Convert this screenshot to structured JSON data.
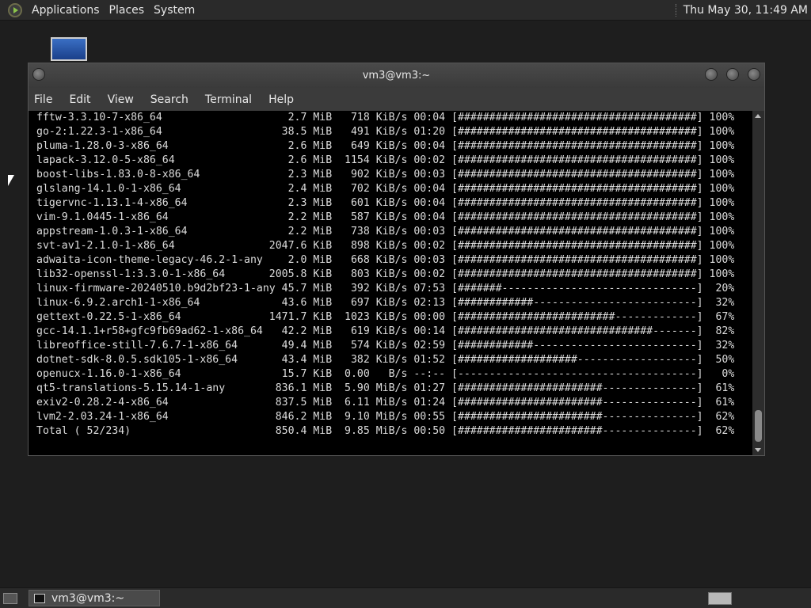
{
  "top_panel": {
    "menus": [
      "Applications",
      "Places",
      "System"
    ],
    "clock": "Thu May 30, 11:49 AM"
  },
  "window": {
    "title": "vm3@vm3:~",
    "menu": [
      "File",
      "Edit",
      "View",
      "Search",
      "Terminal",
      "Help"
    ]
  },
  "terminal": {
    "lines": [
      "fftw-3.3.10-7-x86_64                    2.7 MiB   718 KiB/s 00:04 [######################################] 100%",
      "go-2:1.22.3-1-x86_64                   38.5 MiB   491 KiB/s 01:20 [######################################] 100%",
      "pluma-1.28.0-3-x86_64                   2.6 MiB   649 KiB/s 00:04 [######################################] 100%",
      "lapack-3.12.0-5-x86_64                  2.6 MiB  1154 KiB/s 00:02 [######################################] 100%",
      "boost-libs-1.83.0-8-x86_64              2.3 MiB   902 KiB/s 00:03 [######################################] 100%",
      "glslang-14.1.0-1-x86_64                 2.4 MiB   702 KiB/s 00:04 [######################################] 100%",
      "tigervnc-1.13.1-4-x86_64                2.3 MiB   601 KiB/s 00:04 [######################################] 100%",
      "vim-9.1.0445-1-x86_64                   2.2 MiB   587 KiB/s 00:04 [######################################] 100%",
      "appstream-1.0.3-1-x86_64                2.2 MiB   738 KiB/s 00:03 [######################################] 100%",
      "svt-av1-2.1.0-1-x86_64               2047.6 KiB   898 KiB/s 00:02 [######################################] 100%",
      "adwaita-icon-theme-legacy-46.2-1-any    2.0 MiB   668 KiB/s 00:03 [######################################] 100%",
      "lib32-openssl-1:3.3.0-1-x86_64       2005.8 KiB   803 KiB/s 00:02 [######################################] 100%",
      "linux-firmware-20240510.b9d2bf23-1-any 45.7 MiB   392 KiB/s 07:53 [#######-------------------------------]  20%",
      "linux-6.9.2.arch1-1-x86_64             43.6 MiB   697 KiB/s 02:13 [############--------------------------]  32%",
      "gettext-0.22.5-1-x86_64              1471.7 KiB  1023 KiB/s 00:00 [#########################-------------]  67%",
      "gcc-14.1.1+r58+gfc9fb69ad62-1-x86_64   42.2 MiB   619 KiB/s 00:14 [###############################-------]  82%",
      "libreoffice-still-7.6.7-1-x86_64       49.4 MiB   574 KiB/s 02:59 [############--------------------------]  32%",
      "dotnet-sdk-8.0.5.sdk105-1-x86_64       43.4 MiB   382 KiB/s 01:52 [###################-------------------]  50%",
      "openucx-1.16.0-1-x86_64                15.7 KiB  0.00   B/s --:-- [--------------------------------------]   0%",
      "qt5-translations-5.15.14-1-any        836.1 MiB  5.90 MiB/s 01:27 [#######################---------------]  61%",
      "exiv2-0.28.2-4-x86_64                 837.5 MiB  6.11 MiB/s 01:24 [#######################---------------]  61%",
      "lvm2-2.03.24-1-x86_64                 846.2 MiB  9.10 MiB/s 00:55 [#######################---------------]  62%",
      "Total ( 52/234)                       850.4 MiB  9.85 MiB/s 00:50 [#######################---------------]  62%"
    ]
  },
  "taskbar": {
    "item_label": "vm3@vm3:~"
  },
  "icons": {
    "panel_logo": "mate-logo-icon",
    "desktop": "computer-desktop-icon",
    "terminal": "terminal-icon"
  }
}
